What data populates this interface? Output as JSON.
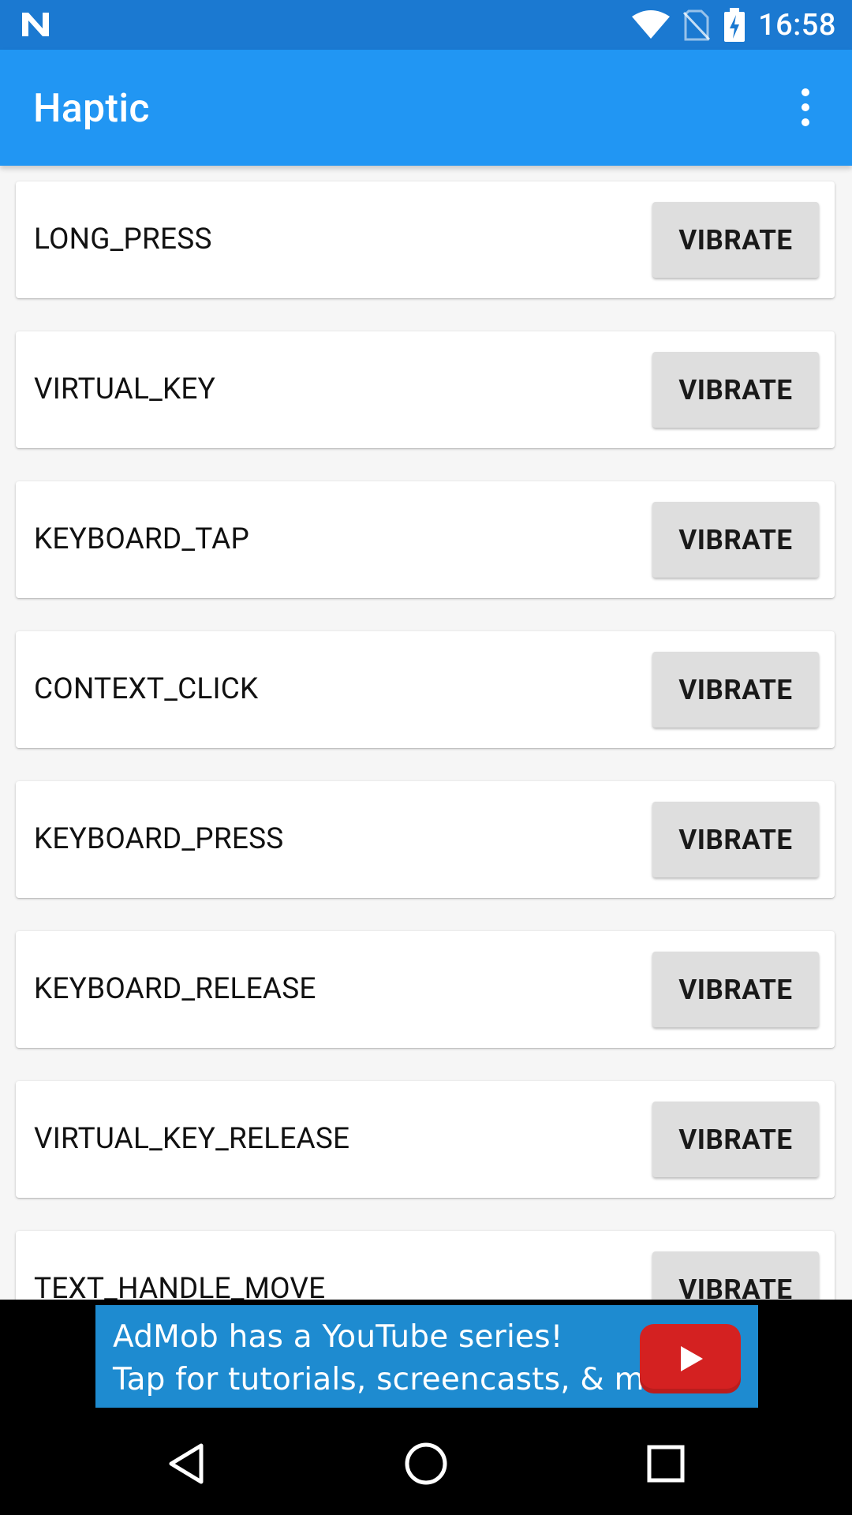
{
  "status_bar": {
    "time": "16:58",
    "icons": [
      "notification-n-icon",
      "wifi-icon",
      "no-sim-icon",
      "battery-charging-icon"
    ]
  },
  "app_bar": {
    "title": "Haptic",
    "overflow_icon": "more-vert-icon"
  },
  "haptics": [
    {
      "label": "LONG_PRESS",
      "button": "VIBRATE"
    },
    {
      "label": "VIRTUAL_KEY",
      "button": "VIBRATE"
    },
    {
      "label": "KEYBOARD_TAP",
      "button": "VIBRATE"
    },
    {
      "label": "CONTEXT_CLICK",
      "button": "VIBRATE"
    },
    {
      "label": "KEYBOARD_PRESS",
      "button": "VIBRATE"
    },
    {
      "label": "KEYBOARD_RELEASE",
      "button": "VIBRATE"
    },
    {
      "label": "VIRTUAL_KEY_RELEASE",
      "button": "VIBRATE"
    },
    {
      "label": "TEXT_HANDLE_MOVE",
      "button": "VIBRATE"
    }
  ],
  "ad": {
    "line1": "AdMob has a YouTube series!",
    "line2": "Tap for tutorials, screencasts, & more.",
    "icon": "youtube-play-icon"
  },
  "nav_bar": {
    "icons": [
      "back-icon",
      "home-icon",
      "recents-icon"
    ]
  },
  "colors": {
    "status_bar": "#1b79d1",
    "app_bar": "#2196f3",
    "background": "#f6f6f6",
    "button": "#dedede",
    "ad_banner": "#1e8bd0",
    "youtube_red": "#d42121"
  }
}
